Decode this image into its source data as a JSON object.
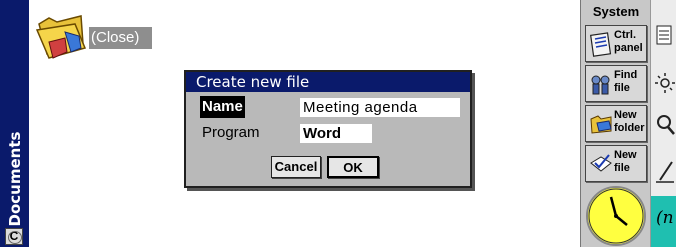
{
  "sidebar": {
    "label": "Documents",
    "c_icon": "C"
  },
  "folder": {
    "close_label": "(Close)"
  },
  "dialog": {
    "title": "Create new file",
    "name_label": "Name",
    "name_value": "Meeting agenda",
    "program_label": "Program",
    "program_value": "Word",
    "cancel_label": "Cancel",
    "ok_label": "OK"
  },
  "system": {
    "header": "System",
    "items": [
      {
        "label": "Ctrl.\npanel",
        "icon": "control-panel-icon"
      },
      {
        "label": "Find\nfile",
        "icon": "find-file-icon"
      },
      {
        "label": "New\nfolder",
        "icon": "new-folder-icon"
      },
      {
        "label": "New\nfile",
        "icon": "new-file-icon"
      }
    ]
  },
  "colors": {
    "accent": "#0a1a6b",
    "dialog_bg": "#b9b9b9",
    "panel_bg": "#c8c8c8",
    "teal": "#1fbfb0"
  }
}
